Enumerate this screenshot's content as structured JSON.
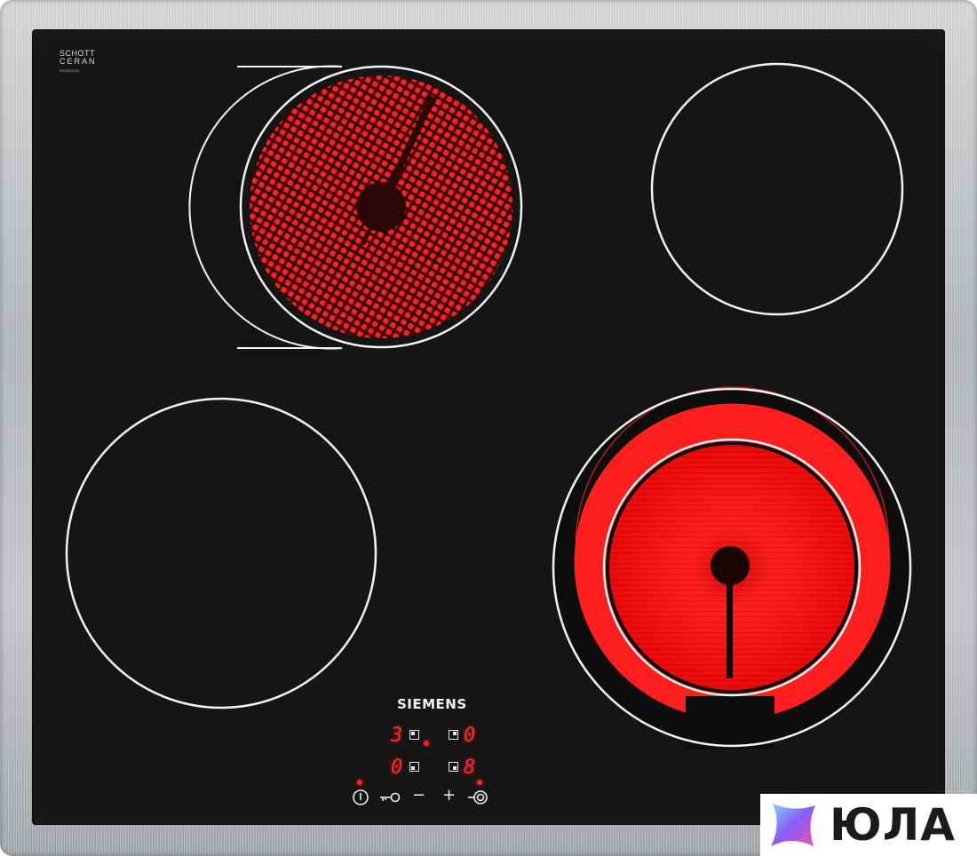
{
  "glass": {
    "certification_brand_line1": "SCHOTT",
    "certification_brand_line2": "CERAN",
    "serial_text": "9000870433"
  },
  "brand": {
    "name": "SIEMENS"
  },
  "display": {
    "zone_front_left_level": "3",
    "zone_rear_left_level": "0",
    "zone_front_right_level": "0",
    "zone_rear_right_level": "8"
  },
  "controls": [
    {
      "name": "power",
      "icon": "power-icon"
    },
    {
      "name": "child-lock",
      "icon": "key-icon"
    },
    {
      "name": "minus",
      "label": "−"
    },
    {
      "name": "plus",
      "label": "+"
    },
    {
      "name": "dual-zone",
      "icon": "dual-circuit-icon"
    }
  ],
  "zones": [
    {
      "id": "rear-left",
      "type": "oval-extended",
      "active": true
    },
    {
      "id": "rear-right",
      "type": "single",
      "active": false
    },
    {
      "id": "front-left",
      "type": "single",
      "active": false
    },
    {
      "id": "front-right",
      "type": "dual",
      "active": true
    }
  ],
  "colors": {
    "glass": "#151515",
    "heat": "#ff1a1a",
    "ring": "#f4f4f4",
    "display": "#ff2a2a"
  },
  "watermark": {
    "icon": "yula-logo-icon",
    "text": "ЮЛА"
  }
}
